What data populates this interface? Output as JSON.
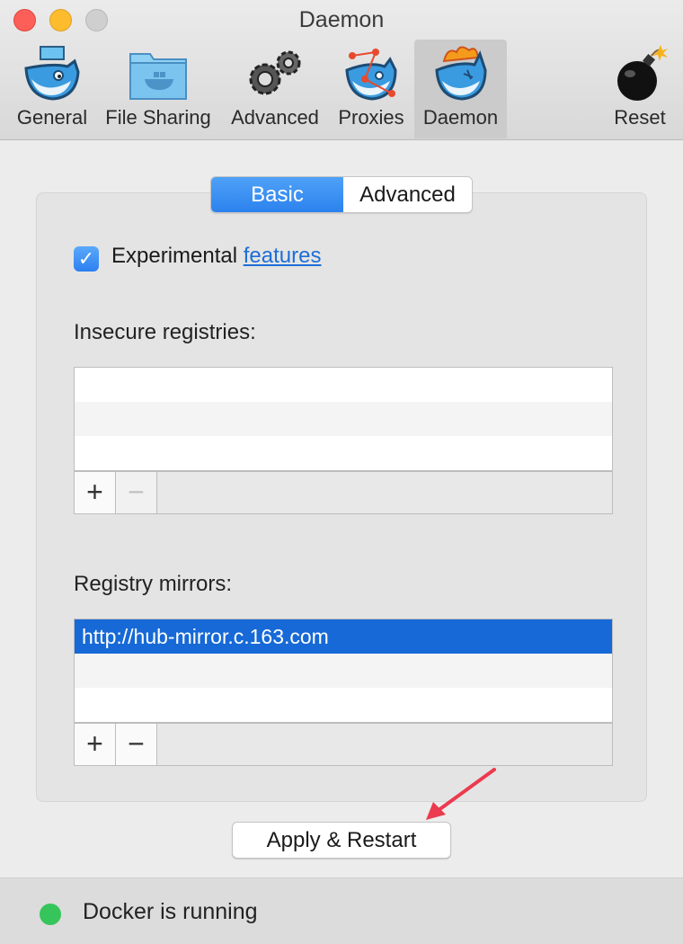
{
  "window": {
    "title": "Daemon"
  },
  "toolbar": {
    "items": [
      {
        "label": "General",
        "icon": "docker-whale-icon"
      },
      {
        "label": "File Sharing",
        "icon": "folder-icon"
      },
      {
        "label": "Advanced",
        "icon": "gears-icon"
      },
      {
        "label": "Proxies",
        "icon": "proxy-whale-icon"
      },
      {
        "label": "Daemon",
        "icon": "daemon-whale-icon",
        "selected": true
      },
      {
        "label": "Reset",
        "icon": "bomb-icon"
      }
    ]
  },
  "tabs": [
    {
      "label": "Basic",
      "active": true
    },
    {
      "label": "Advanced",
      "active": false
    }
  ],
  "experimental": {
    "checked": true,
    "label": "Experimental",
    "link": "features"
  },
  "insecure_registries": {
    "label": "Insecure registries:",
    "items": []
  },
  "registry_mirrors": {
    "label": "Registry mirrors:",
    "items": [
      "http://hub-mirror.c.163.com"
    ]
  },
  "buttons": {
    "add": "+",
    "remove": "−",
    "apply": "Apply & Restart"
  },
  "status": {
    "text": "Docker is running",
    "color": "#36c55a"
  },
  "colors": {
    "accent": "#2c82ee",
    "selection": "#1669d6",
    "annotation_arrow": "#ec3a4f"
  }
}
